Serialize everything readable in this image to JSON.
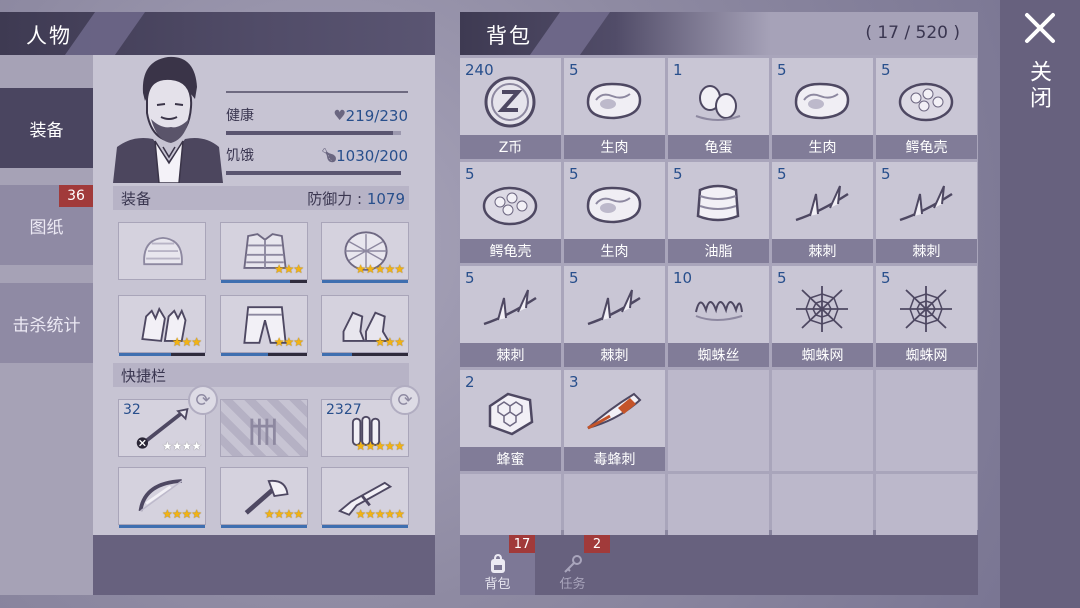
{
  "character": {
    "title": "人物",
    "health": {
      "label": "健康",
      "value": "219/230",
      "fraction": 0.952
    },
    "hunger": {
      "label": "饥饿",
      "value": "1030/200",
      "fraction": 1.0
    },
    "equipment_label": "装备",
    "defense_label": "防御力 : ",
    "defense_value": "1079",
    "quickbar_label": "快捷栏"
  },
  "side_tabs": [
    {
      "label": "装备",
      "active": true
    },
    {
      "label": "图纸",
      "badge": "36"
    },
    {
      "label": "击杀统计"
    }
  ],
  "equipment": [
    {
      "icon": "cap-icon",
      "stars": 0,
      "max": 0,
      "durability": 0
    },
    {
      "icon": "vest-armor-icon",
      "stars": 3,
      "max": 3,
      "durability": 0.8
    },
    {
      "icon": "turtle-shell-armor-icon",
      "stars": 5,
      "max": 5,
      "durability": 1.0
    },
    {
      "icon": "gloves-icon",
      "stars": 3,
      "max": 3,
      "durability": 0.6
    },
    {
      "icon": "pants-icon",
      "stars": 3,
      "max": 3,
      "durability": 0.55
    },
    {
      "icon": "boots-icon",
      "stars": 3,
      "max": 3,
      "durability": 0.35
    }
  ],
  "quickbar": [
    {
      "icon": "spear-icon",
      "count": "32",
      "stars": 0,
      "max": 4,
      "durability": 0
    },
    {
      "icon": "empty-slot-icon",
      "count": "",
      "stars": 0,
      "max": 0,
      "durability": 0
    },
    {
      "icon": "bullets-icon",
      "count": "2327",
      "stars": 5,
      "max": 5,
      "durability": 0
    },
    {
      "icon": "bow-icon",
      "count": "",
      "stars": 4,
      "max": 4,
      "durability": 1.0
    },
    {
      "icon": "axe-icon",
      "count": "",
      "stars": 4,
      "max": 4,
      "durability": 1.0
    },
    {
      "icon": "rifle-icon",
      "count": "",
      "stars": 5,
      "max": 5,
      "durability": 1.0
    }
  ],
  "backpack": {
    "title": "背包",
    "capacity": "( 17 / 520 )",
    "items": [
      {
        "qty": "240",
        "name": "Z币",
        "icon": "z-coin-icon"
      },
      {
        "qty": "5",
        "name": "生肉",
        "icon": "raw-meat-icon"
      },
      {
        "qty": "1",
        "name": "龟蛋",
        "icon": "turtle-egg-icon"
      },
      {
        "qty": "5",
        "name": "生肉",
        "icon": "raw-meat-icon"
      },
      {
        "qty": "5",
        "name": "鳄龟壳",
        "icon": "turtle-shell-icon"
      },
      {
        "qty": "5",
        "name": "鳄龟壳",
        "icon": "turtle-shell-icon"
      },
      {
        "qty": "5",
        "name": "生肉",
        "icon": "raw-meat-icon"
      },
      {
        "qty": "5",
        "name": "油脂",
        "icon": "fat-icon"
      },
      {
        "qty": "5",
        "name": "棘刺",
        "icon": "thorn-icon"
      },
      {
        "qty": "5",
        "name": "棘刺",
        "icon": "thorn-icon"
      },
      {
        "qty": "5",
        "name": "棘刺",
        "icon": "thorn-icon"
      },
      {
        "qty": "5",
        "name": "棘刺",
        "icon": "thorn-icon"
      },
      {
        "qty": "10",
        "name": "蜘蛛丝",
        "icon": "spider-silk-icon"
      },
      {
        "qty": "5",
        "name": "蜘蛛网",
        "icon": "spider-web-icon"
      },
      {
        "qty": "5",
        "name": "蜘蛛网",
        "icon": "spider-web-icon"
      },
      {
        "qty": "2",
        "name": "蜂蜜",
        "icon": "honeycomb-icon"
      },
      {
        "qty": "3",
        "name": "毒蜂刺",
        "icon": "wasp-stinger-icon"
      }
    ]
  },
  "bag_tabs": [
    {
      "label": "背包",
      "badge": "17",
      "icon": "backpack-icon"
    },
    {
      "label": "任务",
      "badge": "2",
      "icon": "key-icon"
    }
  ],
  "close": {
    "label": "关闭",
    "icon": "close-icon"
  }
}
